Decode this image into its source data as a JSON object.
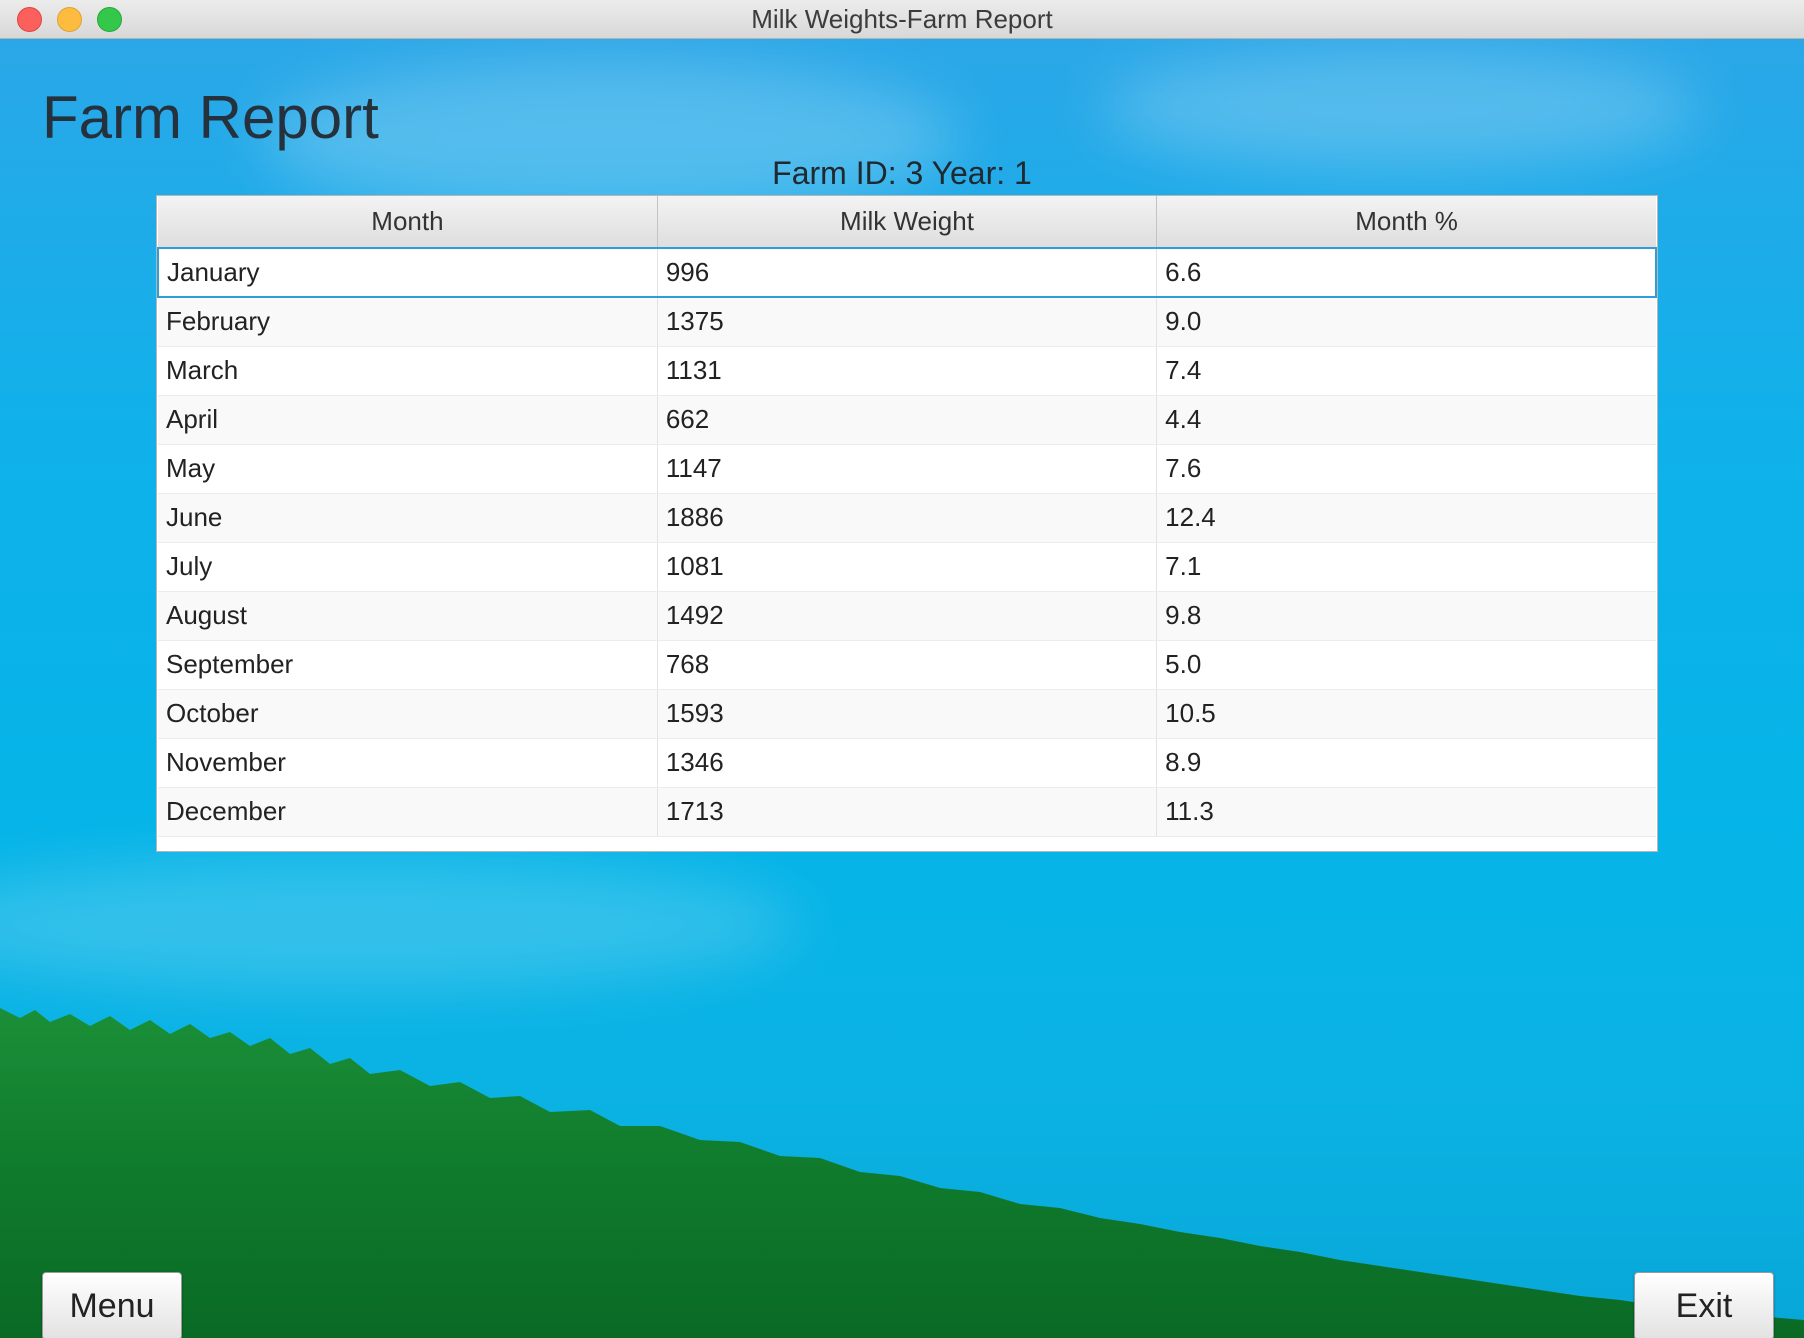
{
  "window": {
    "title": "Milk Weights-Farm Report"
  },
  "page": {
    "title": "Farm Report",
    "subtitle": "Farm ID: 3 Year: 1"
  },
  "table": {
    "columns": [
      "Month",
      "Milk Weight",
      "Month %"
    ],
    "rows": [
      [
        "January",
        "996",
        "6.6"
      ],
      [
        "February",
        "1375",
        "9.0"
      ],
      [
        "March",
        "1131",
        "7.4"
      ],
      [
        "April",
        "662",
        "4.4"
      ],
      [
        "May",
        "1147",
        "7.6"
      ],
      [
        "June",
        "1886",
        "12.4"
      ],
      [
        "July",
        "1081",
        "7.1"
      ],
      [
        "August",
        "1492",
        "9.8"
      ],
      [
        "September",
        "768",
        "5.0"
      ],
      [
        "October",
        "1593",
        "10.5"
      ],
      [
        "November",
        "1346",
        "8.9"
      ],
      [
        "December",
        "1713",
        "11.3"
      ]
    ],
    "selected_row": "January"
  },
  "buttons": {
    "menu_label": "Menu",
    "exit_label": "Exit"
  },
  "colors": {
    "sky": "#05b4e8",
    "forest": "#0e7a2a",
    "selection": "#2e9fd6"
  }
}
